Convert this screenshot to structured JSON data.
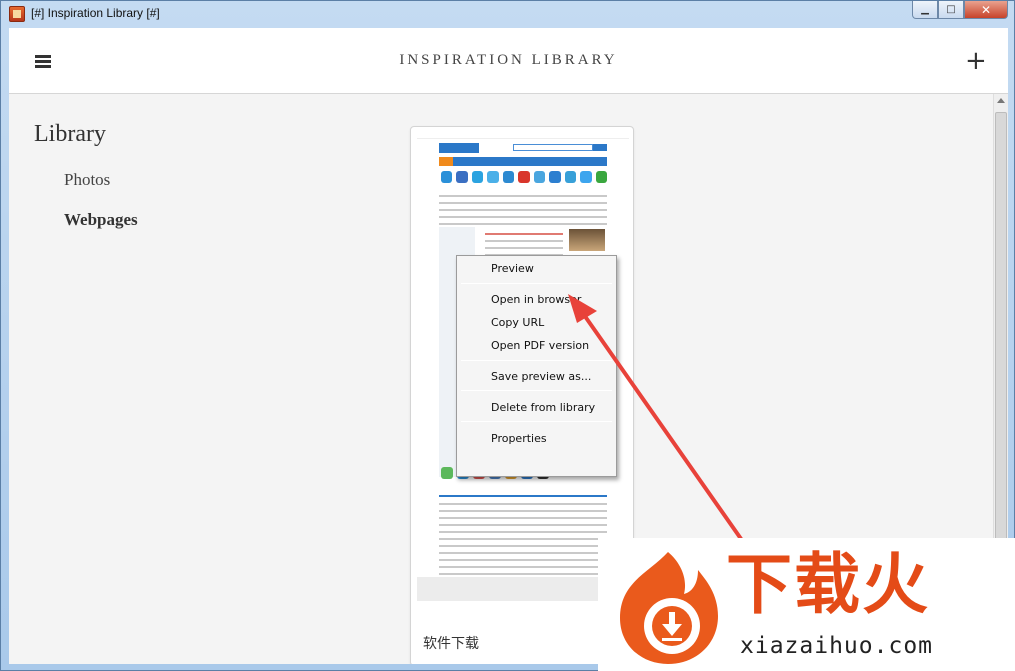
{
  "window": {
    "title": "[#] Inspiration Library [#]",
    "buttons": {
      "minimize": "▁",
      "maximize": "□",
      "close": "✕"
    }
  },
  "header": {
    "menu_icon": "hamburger-icon",
    "title": "INSPIRATION LIBRARY",
    "add_label": "+"
  },
  "sidebar": {
    "heading": "Library",
    "items": [
      {
        "label": "Photos",
        "active": false
      },
      {
        "label": "Webpages",
        "active": true
      }
    ]
  },
  "card": {
    "caption": "软件下载"
  },
  "context_menu": {
    "items": [
      {
        "label": "Preview"
      },
      {
        "label": "Open in browser"
      },
      {
        "label": "Copy URL"
      },
      {
        "label": "Open PDF version"
      },
      {
        "label": "Save preview as..."
      },
      {
        "label": "Delete from library"
      },
      {
        "label": "Properties"
      }
    ]
  },
  "annotation": {
    "color": "#e8423a",
    "points_to": "Open in browser"
  },
  "watermark": {
    "cn_text": "下载火",
    "url": "xiazaihuo.com",
    "color": "#e44b17"
  },
  "colors": {
    "accent": "#2b78c8",
    "window_frame": "#a9c9ea"
  }
}
